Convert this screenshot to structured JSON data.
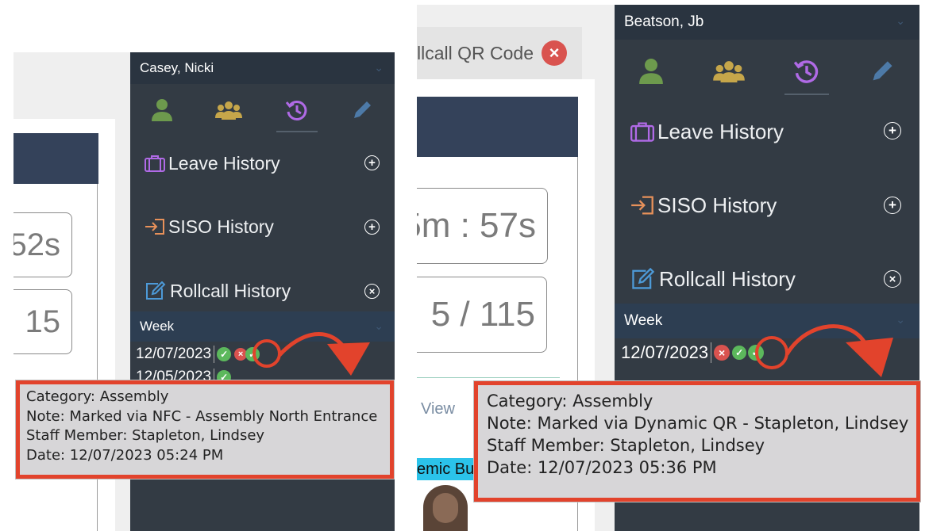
{
  "left": {
    "user_name": "Casey, Nicki",
    "timer_value": "52s",
    "count_value": "15",
    "sections": [
      {
        "label": "Leave History",
        "action": "plus"
      },
      {
        "label": "SISO History",
        "action": "plus"
      },
      {
        "label": "Rollcall History",
        "action": "close"
      }
    ],
    "week_label": "Week",
    "dates": [
      "12/07/2023",
      "12/05/2023"
    ],
    "tooltip": {
      "category": "Category: Assembly",
      "note": "Note: Marked via NFC - Assembly North Entrance",
      "staff": "Staff Member: Stapleton, Lindsey",
      "date": "Date: 12/07/2023 05:24 PM"
    }
  },
  "right": {
    "user_name": "Beatson, Jb",
    "tab_title": "llcall QR Code",
    "timer_value": "5m : 57s",
    "count_value": "5 / 115",
    "view_label": "View",
    "building_label": "emic Bui",
    "sections": [
      {
        "label": "Leave History",
        "action": "plus"
      },
      {
        "label": "SISO History",
        "action": "plus"
      },
      {
        "label": "Rollcall History",
        "action": "close"
      }
    ],
    "week_label": "Week",
    "dates": [
      "12/07/2023"
    ],
    "tooltip": {
      "category": "Category: Assembly",
      "note": "Note: Marked via Dynamic QR - Stapleton, Lindsey",
      "staff": "Staff Member: Stapleton, Lindsey",
      "date": "Date: 12/07/2023 05:36 PM"
    }
  },
  "colors": {
    "highlight": "#e2432c",
    "sidebar": "#333b44",
    "header": "#34425a",
    "status_ok": "#5cb85c",
    "status_bad": "#d9534f",
    "leave_icon": "#b06ae6",
    "siso_icon": "#e8915a",
    "rollcall_icon": "#4d9ad8"
  }
}
